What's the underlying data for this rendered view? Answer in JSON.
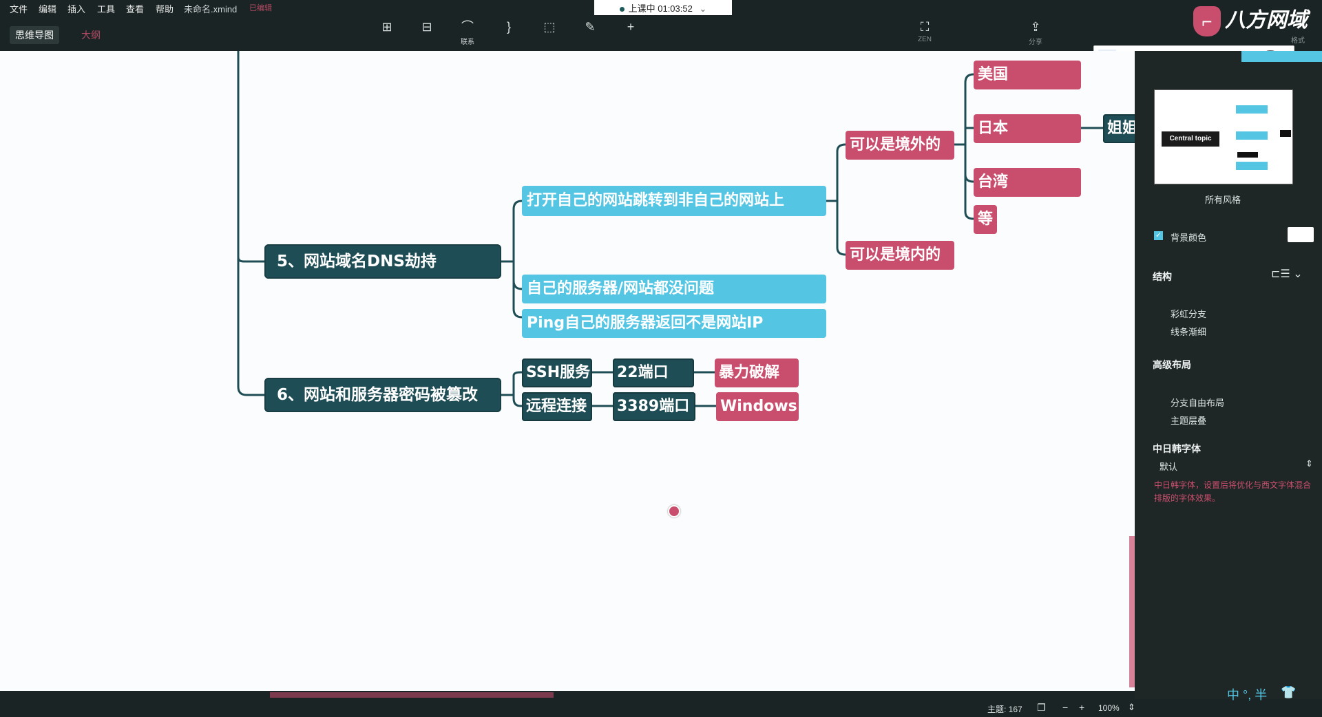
{
  "menu": [
    "文件",
    "编辑",
    "插入",
    "工具",
    "查看",
    "帮助"
  ],
  "file_name": "未命名.xmind",
  "file_state": "已编辑",
  "view_tabs": {
    "mindmap": "思维导图",
    "outline": "大纲"
  },
  "status": {
    "text": "上课中 01:03:52",
    "caret": "⌄"
  },
  "toolbar": {
    "link": "联系",
    "zen": "ZEN",
    "share": "分享",
    "format": "格式"
  },
  "watermark": "八方网域",
  "mindmap": {
    "t5": "5、网站域名DNS劫持",
    "t6": "6、网站和服务器密码被篡改",
    "c1": "打开自己的网站跳转到非自己的网站上",
    "c2": "自己的服务器/网站都没问题",
    "c3": "Ping自己的服务器返回不是网站IP",
    "abroad": "可以是境外的",
    "domestic": "可以是境内的",
    "usa": "美国",
    "japan": "日本",
    "taiwan": "台湾",
    "etc": "等",
    "partial": "姐姐",
    "ssh": "SSH服务",
    "port22": "22端口",
    "brute": "暴力破解",
    "remote": "远程连接",
    "port3389": "3389端口",
    "windows": "Windows"
  },
  "panel": {
    "thumb_label": "Central topic",
    "all_styles": "所有风格",
    "bg_color": "背景颜色",
    "structure": "结构",
    "rainbow": "彩虹分支",
    "taper": "线条渐细",
    "advanced": "高级布局",
    "free": "分支自由布局",
    "overlap": "主题层叠",
    "cjk_font": "中日韩字体",
    "default": "默认",
    "cjk_hint": "中日韩字体，设置后将优化与西文字体混合排版的字体效果。"
  },
  "bottom": {
    "topics": "主题: 167",
    "zoom": "100%",
    "ime": "中 °, 半"
  },
  "colors": {
    "dark_node": "#1f4d55",
    "cyan_node": "#54c5e3",
    "pink_node": "#c94e6d",
    "canvas": "#fbfcfd",
    "chrome": "#1b2424"
  }
}
